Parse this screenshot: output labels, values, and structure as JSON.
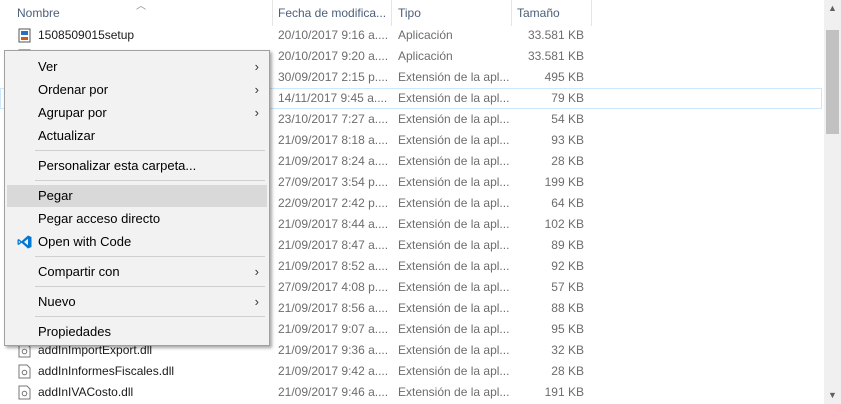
{
  "columns": {
    "name": "Nombre",
    "date": "Fecha de modifica...",
    "type": "Tipo",
    "size": "Tamaño"
  },
  "files": [
    {
      "name": "1508509015setup",
      "date": "20/10/2017 9:16 a....",
      "type": "Aplicación",
      "size": "33.581 KB",
      "icon": "setup-app-icon"
    },
    {
      "name": "",
      "date": "20/10/2017 9:20 a....",
      "type": "Aplicación",
      "size": "33.581 KB",
      "icon": "app-icon"
    },
    {
      "name": "",
      "date": "30/09/2017 2:15 p....",
      "type": "Extensión de la apl...",
      "size": "495 KB",
      "icon": "dll-icon"
    },
    {
      "name": "",
      "date": "14/11/2017 9:45 a....",
      "type": "Extensión de la apl...",
      "size": "79 KB",
      "icon": "dll-icon"
    },
    {
      "name": "",
      "date": "23/10/2017 7:27 a....",
      "type": "Extensión de la apl...",
      "size": "54 KB",
      "icon": "dll-icon"
    },
    {
      "name": "",
      "date": "21/09/2017 8:18 a....",
      "type": "Extensión de la apl...",
      "size": "93 KB",
      "icon": "dll-icon"
    },
    {
      "name": "",
      "date": "21/09/2017 8:24 a....",
      "type": "Extensión de la apl...",
      "size": "28 KB",
      "icon": "dll-icon"
    },
    {
      "name": "",
      "date": "27/09/2017 3:54 p....",
      "type": "Extensión de la apl...",
      "size": "199 KB",
      "icon": "dll-icon"
    },
    {
      "name": "",
      "date": "22/09/2017 2:42 p....",
      "type": "Extensión de la apl...",
      "size": "64 KB",
      "icon": "dll-icon"
    },
    {
      "name": "",
      "date": "21/09/2017 8:44 a....",
      "type": "Extensión de la apl...",
      "size": "102 KB",
      "icon": "dll-icon"
    },
    {
      "name": "",
      "date": "21/09/2017 8:47 a....",
      "type": "Extensión de la apl...",
      "size": "89 KB",
      "icon": "dll-icon"
    },
    {
      "name": "",
      "date": "21/09/2017 8:52 a....",
      "type": "Extensión de la apl...",
      "size": "92 KB",
      "icon": "dll-icon"
    },
    {
      "name": "",
      "date": "27/09/2017 4:08 p....",
      "type": "Extensión de la apl...",
      "size": "57 KB",
      "icon": "dll-icon"
    },
    {
      "name": "",
      "date": "21/09/2017 8:56 a....",
      "type": "Extensión de la apl...",
      "size": "88 KB",
      "icon": "dll-icon"
    },
    {
      "name": "",
      "date": "21/09/2017 9:07 a....",
      "type": "Extensión de la apl...",
      "size": "95 KB",
      "icon": "dll-icon"
    },
    {
      "name": "addInImportExport.dll",
      "date": "21/09/2017 9:36 a....",
      "type": "Extensión de la apl...",
      "size": "32 KB",
      "icon": "dll-icon"
    },
    {
      "name": "addInInformesFiscales.dll",
      "date": "21/09/2017 9:42 a....",
      "type": "Extensión de la apl...",
      "size": "28 KB",
      "icon": "dll-icon"
    },
    {
      "name": "addInIVACosto.dll",
      "date": "21/09/2017 9:46 a....",
      "type": "Extensión de la apl...",
      "size": "191 KB",
      "icon": "dll-icon"
    }
  ],
  "menu": {
    "ver": "Ver",
    "ordenar": "Ordenar por",
    "agrupar": "Agrupar por",
    "actualizar": "Actualizar",
    "personalizar": "Personalizar esta carpeta...",
    "pegar": "Pegar",
    "pegar_acceso": "Pegar acceso directo",
    "open_code": "Open with Code",
    "compartir": "Compartir con",
    "nuevo": "Nuevo",
    "propiedades": "Propiedades"
  },
  "colors": {
    "selection_outline": "#cce8ff",
    "menu_hover": "#d9d9d9",
    "vscode_blue": "#0078d4"
  }
}
